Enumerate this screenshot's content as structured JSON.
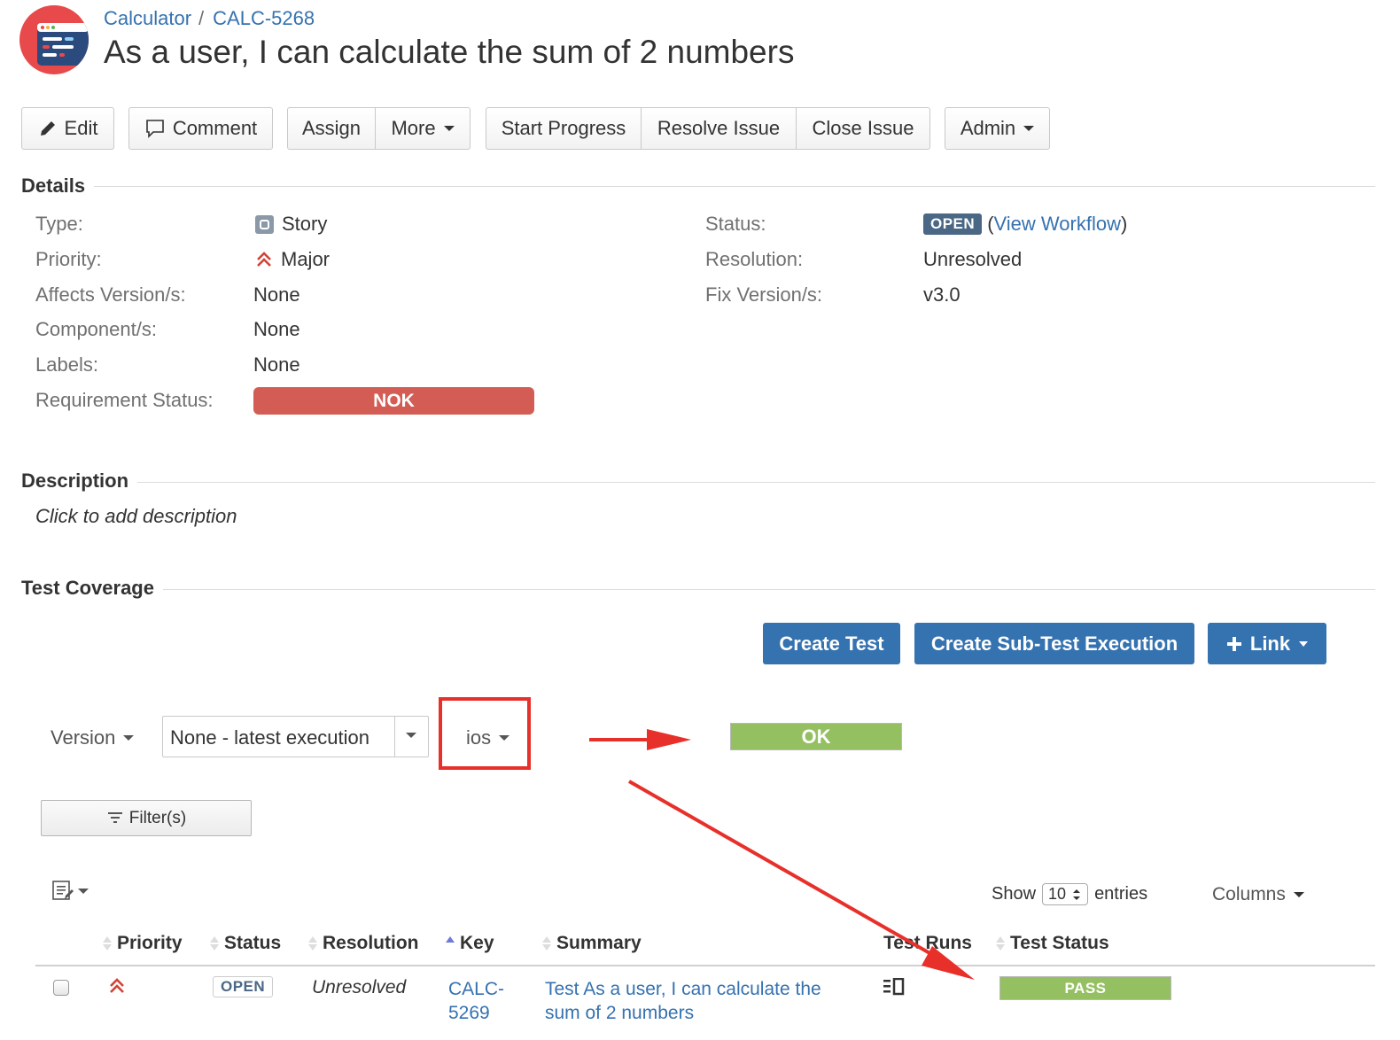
{
  "breadcrumb": {
    "project": "Calculator",
    "separator": "/",
    "issue_key": "CALC-5268"
  },
  "issue": {
    "title": "As a user, I can calculate the sum of 2 numbers"
  },
  "toolbar": {
    "edit": "Edit",
    "comment": "Comment",
    "assign": "Assign",
    "more": "More",
    "start_progress": "Start Progress",
    "resolve_issue": "Resolve Issue",
    "close_issue": "Close Issue",
    "admin": "Admin"
  },
  "details": {
    "section_title": "Details",
    "left": [
      {
        "label": "Type:",
        "value": "Story"
      },
      {
        "label": "Priority:",
        "value": "Major"
      },
      {
        "label": "Affects Version/s:",
        "value": "None"
      },
      {
        "label": "Component/s:",
        "value": "None"
      },
      {
        "label": "Labels:",
        "value": "None"
      },
      {
        "label": "Requirement Status:",
        "value": "NOK"
      }
    ],
    "right": [
      {
        "label": "Status:",
        "value": "OPEN",
        "link": "View Workflow",
        "paren_open": "(",
        "paren_close": ")"
      },
      {
        "label": "Resolution:",
        "value": "Unresolved"
      },
      {
        "label": "Fix Version/s:",
        "value": "v3.0"
      }
    ]
  },
  "description": {
    "section_title": "Description",
    "placeholder": "Click to add description"
  },
  "test_coverage": {
    "section_title": "Test Coverage",
    "create_test": "Create Test",
    "create_sub_test_execution": "Create Sub-Test Execution",
    "link": "Link",
    "version_label": "Version",
    "version_select": "None - latest execution",
    "environment": "ios",
    "coverage_status": "OK",
    "filter": "Filter(s)",
    "show": "Show",
    "entries_value": "10",
    "entries": "entries",
    "columns": "Columns",
    "table": {
      "headers": [
        "Priority",
        "Status",
        "Resolution",
        "Key",
        "Summary",
        "Test Runs",
        "Test Status"
      ],
      "rows": [
        {
          "status": "OPEN",
          "resolution": "Unresolved",
          "key_line1": "CALC-",
          "key_line2": "5269",
          "summary_line1": "Test As a user, I can calculate the",
          "summary_line2": "sum of 2 numbers",
          "test_status": "PASS"
        }
      ]
    }
  },
  "annotation_color": "#e8302a"
}
